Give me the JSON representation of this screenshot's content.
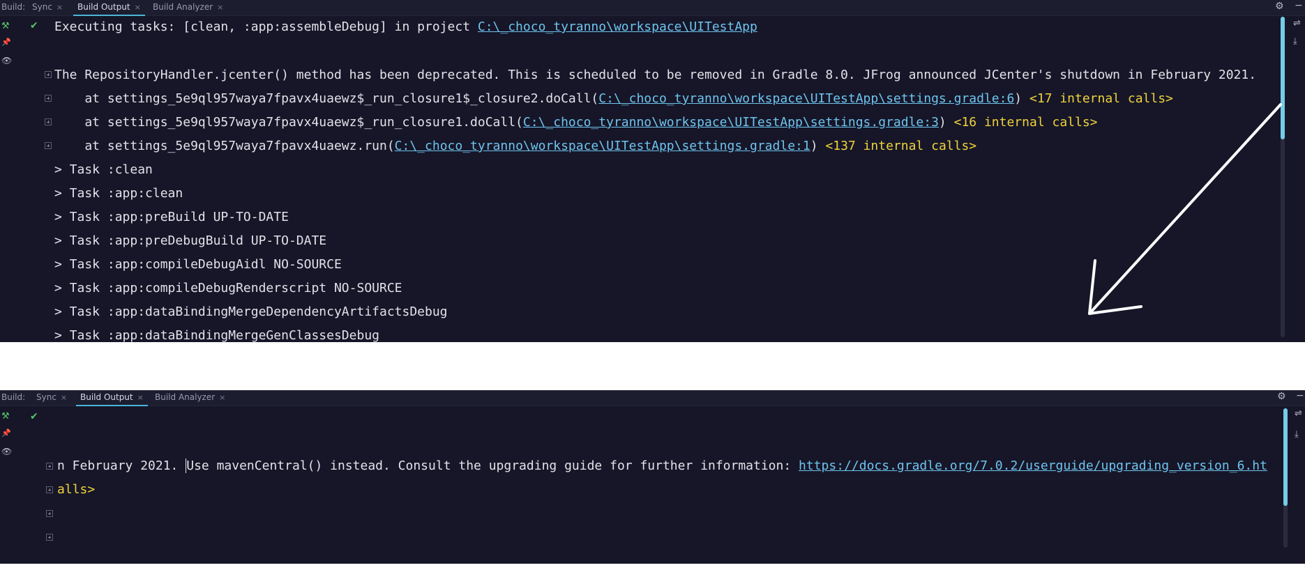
{
  "top": {
    "tabs": {
      "build_label": "Build:",
      "sync": "Sync",
      "build_output": "Build Output",
      "analyzer": "Build Analyzer",
      "close": "×"
    },
    "exec_prefix": "Executing tasks: [clean, :app:assembleDebug] in project ",
    "exec_link": "C:\\_choco_tyranno\\workspace\\UITestApp",
    "warning": "The RepositoryHandler.jcenter() method has been deprecated. This is scheduled to be removed in Gradle 8.0. JFrog announced JCenter's shutdown in February 2021.",
    "stack": [
      {
        "prefix": "    at settings_5e9ql957waya7fpavx4uaewz$_run_closure1$_closure2.doCall(",
        "link": "C:\\_choco_tyranno\\workspace\\UITestApp\\settings.gradle:6",
        "suffix": ") ",
        "internal": "<17 internal calls>"
      },
      {
        "prefix": "    at settings_5e9ql957waya7fpavx4uaewz$_run_closure1.doCall(",
        "link": "C:\\_choco_tyranno\\workspace\\UITestApp\\settings.gradle:3",
        "suffix": ") ",
        "internal": "<16 internal calls>"
      },
      {
        "prefix": "    at settings_5e9ql957waya7fpavx4uaewz.run(",
        "link": "C:\\_choco_tyranno\\workspace\\UITestApp\\settings.gradle:1",
        "suffix": ") ",
        "internal": "<137 internal calls>"
      }
    ],
    "tasks": [
      "> Task :clean",
      "> Task :app:clean",
      "> Task :app:preBuild UP-TO-DATE",
      "> Task :app:preDebugBuild UP-TO-DATE",
      "> Task :app:compileDebugAidl NO-SOURCE",
      "> Task :app:compileDebugRenderscript NO-SOURCE",
      "> Task :app:dataBindingMergeDependencyArtifactsDebug",
      "> Task :app:dataBindingMergeGenClassesDebug"
    ]
  },
  "bottom": {
    "tabs": {
      "build_label": "Build:",
      "sync": "Sync",
      "build_output": "Build Output",
      "analyzer": "Build Analyzer",
      "close": "×"
    },
    "line1_a": "n February 2021. ",
    "line1_b": "Use mavenCentral() instead. Consult the upgrading guide for further information: ",
    "line1_link": "https://docs.gradle.org/7.0.2/userguide/upgrading_version_6.ht",
    "line2": "alls>"
  },
  "icons": {
    "hammer": "⚒",
    "pin": "📌",
    "eye": "👁",
    "check": "✔",
    "gear": "⚙",
    "minus": "−",
    "wrap": "⇌",
    "scroll_end": "⤓"
  },
  "colors": {
    "background": "#161628",
    "link": "#6fc4ee",
    "internal_calls": "#f0d33c",
    "success": "#55c46a",
    "tab_accent": "#4bb6d8"
  }
}
